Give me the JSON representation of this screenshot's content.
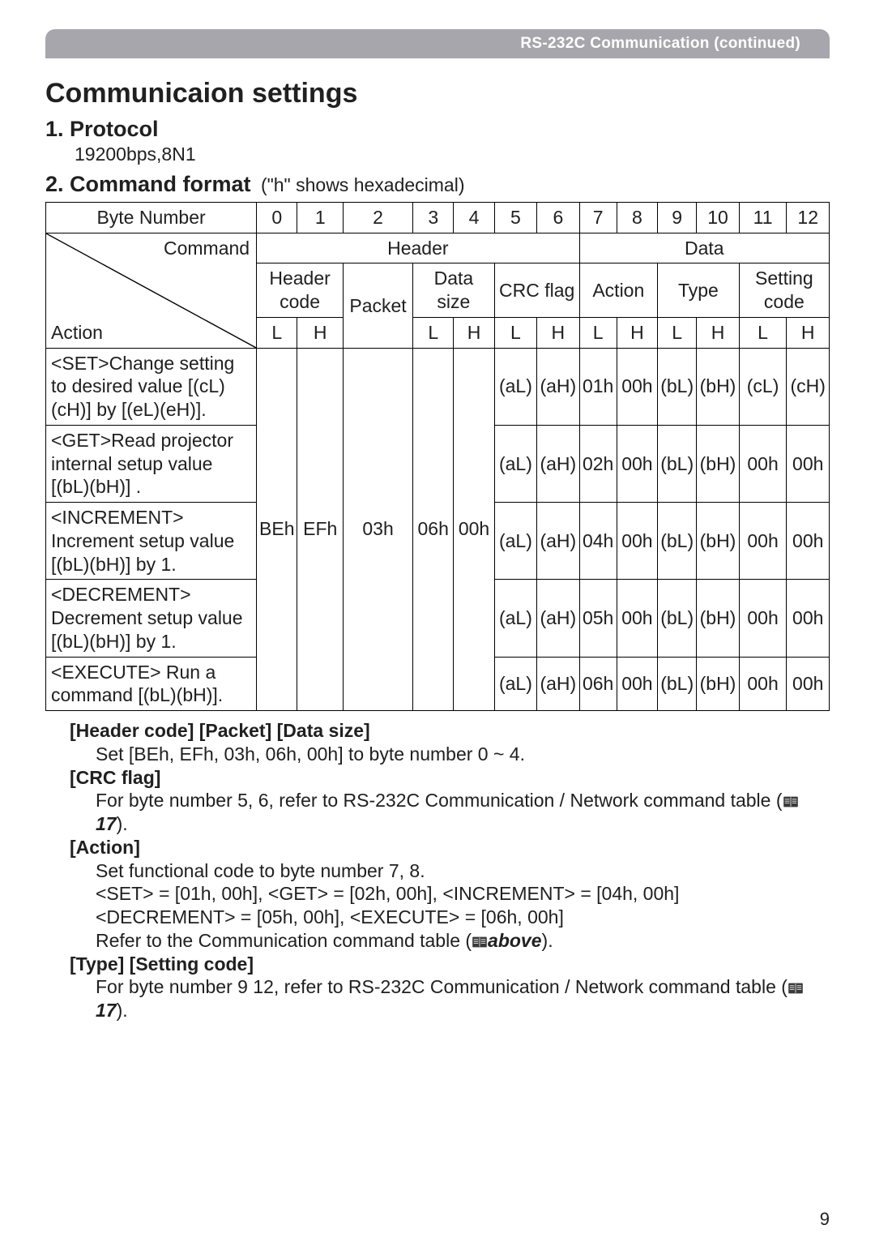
{
  "banner": "RS-232C Communication (continued)",
  "h1": "Communicaion settings",
  "s1": {
    "title": "1. Protocol",
    "value": "19200bps,8N1"
  },
  "s2": {
    "title": "2. Command format",
    "note": "(\"h\" shows hexadecimal)"
  },
  "table": {
    "row_byte": {
      "label": "Byte Number",
      "cells": [
        "0",
        "1",
        "2",
        "3",
        "4",
        "5",
        "6",
        "7",
        "8",
        "9",
        "10",
        "11",
        "12"
      ]
    },
    "row_cmd": {
      "label": "Command",
      "header": "Header",
      "data": "Data"
    },
    "row_grp": {
      "hc": "Header code",
      "pk": "Packet",
      "ds": "Data size",
      "cf": "CRC flag",
      "ac": "Action",
      "ty": "Type",
      "sc": "Setting code"
    },
    "row_act": {
      "label": "Action",
      "cells": [
        "L",
        "H",
        "",
        "L",
        "H",
        "L",
        "H",
        "L",
        "H",
        "L",
        "H",
        "L",
        "H"
      ]
    },
    "shared": {
      "c0": "BEh",
      "c1": "EFh",
      "c2": "03h",
      "c3": "06h",
      "c4": "00h"
    },
    "rows": [
      {
        "action": "<SET>Change setting to desired value [(cL)(cH)] by [(eL)(eH)].",
        "c5": "(aL)",
        "c6": "(aH)",
        "c7": "01h",
        "c8": "00h",
        "c9": "(bL)",
        "c10": "(bH)",
        "c11": "(cL)",
        "c12": "(cH)"
      },
      {
        "action": "<GET>Read projector internal setup value [(bL)(bH)] .",
        "c5": "(aL)",
        "c6": "(aH)",
        "c7": "02h",
        "c8": "00h",
        "c9": "(bL)",
        "c10": "(bH)",
        "c11": "00h",
        "c12": "00h"
      },
      {
        "action": "<INCREMENT> Increment setup value [(bL)(bH)] by 1.",
        "c5": "(aL)",
        "c6": "(aH)",
        "c7": "04h",
        "c8": "00h",
        "c9": "(bL)",
        "c10": "(bH)",
        "c11": "00h",
        "c12": "00h"
      },
      {
        "action": "<DECREMENT> Decrement setup value [(bL)(bH)] by 1.",
        "c5": "(aL)",
        "c6": "(aH)",
        "c7": "05h",
        "c8": "00h",
        "c9": "(bL)",
        "c10": "(bH)",
        "c11": "00h",
        "c12": "00h"
      },
      {
        "action": "<EXECUTE> Run a command [(bL)(bH)].",
        "c5": "(aL)",
        "c6": "(aH)",
        "c7": "06h",
        "c8": "00h",
        "c9": "(bL)",
        "c10": "(bH)",
        "c11": "00h",
        "c12": "00h"
      }
    ]
  },
  "notes": {
    "n1": {
      "title": "[Header code] [Packet] [Data size]",
      "body": "Set [BEh, EFh, 03h, 06h, 00h] to byte number 0 ~ 4."
    },
    "n2": {
      "title": "[CRC flag]",
      "body1": "For byte number 5, 6, refer to RS-232C Communication / Network command table (",
      "ref": "17",
      "body2": ")."
    },
    "n3": {
      "title": "[Action]",
      "l1": "Set functional code to byte number 7, 8.",
      "l2": "<SET> = [01h, 00h], <GET> = [02h, 00h], <INCREMENT> = [04h, 00h]",
      "l3": "<DECREMENT> = [05h, 00h], <EXECUTE> = [06h, 00h]",
      "l4a": "Refer to the Communication command table (",
      "above": "above",
      "l4b": ")."
    },
    "n4": {
      "title": "[Type] [Setting code]",
      "body1": "For byte number 9   12, refer to RS-232C Communication / Network command table (",
      "ref": "17",
      "body2": ")."
    }
  },
  "page_number": "9"
}
